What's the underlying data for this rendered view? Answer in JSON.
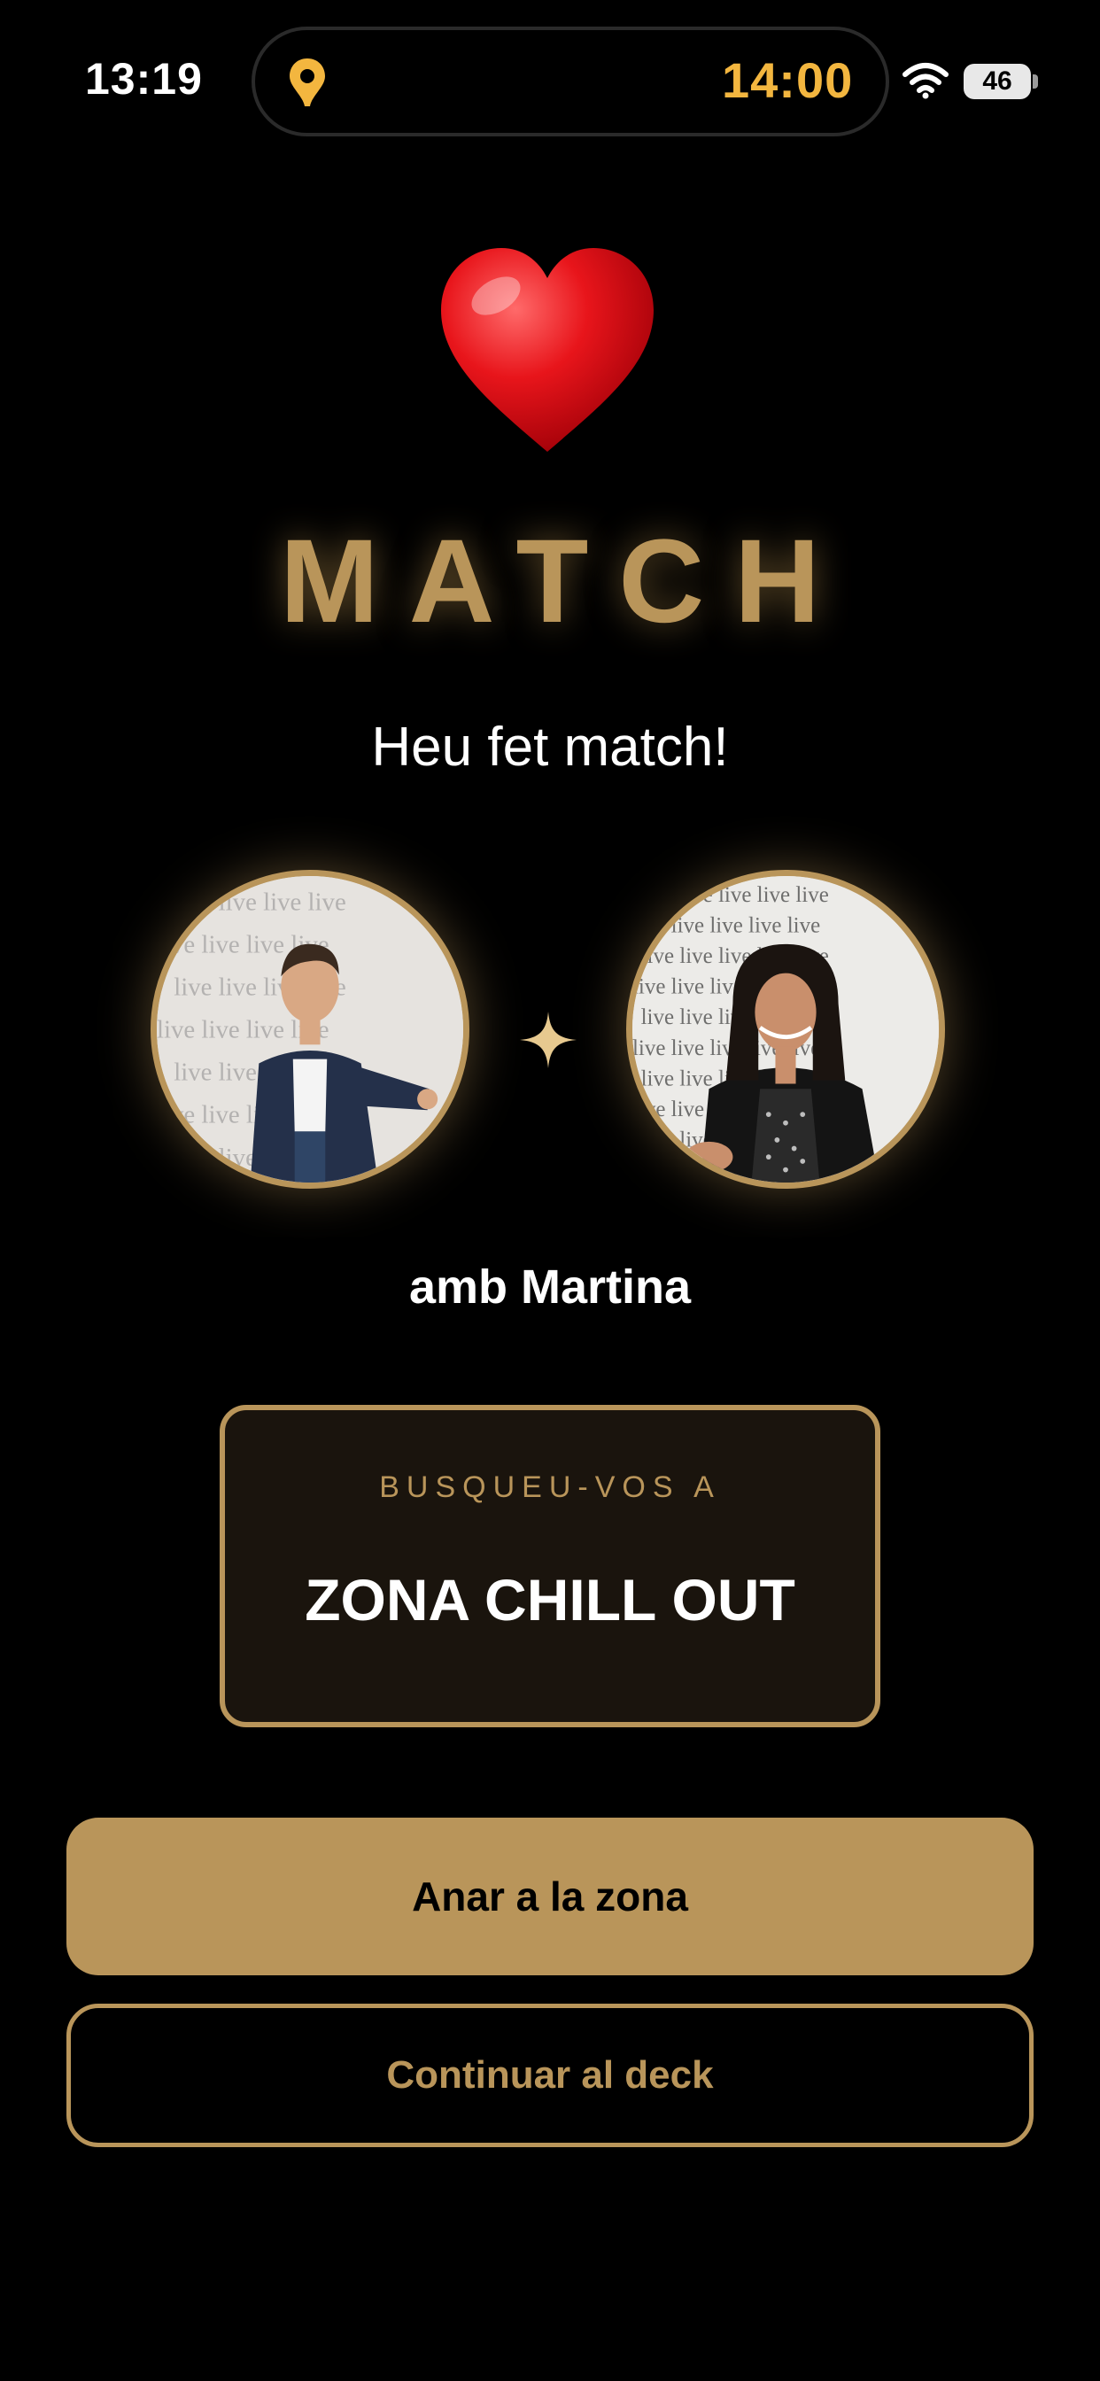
{
  "status_bar": {
    "time": "13:19",
    "island_time": "14:00",
    "battery": "46",
    "icons": [
      "location-pin-icon",
      "wifi-icon",
      "battery-icon"
    ]
  },
  "match": {
    "heart_icon": "heart-icon",
    "title": "MATCH",
    "subtitle": "Heu fet match!",
    "separator_icon": "sparkle-icon",
    "partner_line": "amb Martina"
  },
  "zone_card": {
    "label": "BUSQUEU-VOS A",
    "name": "ZONA CHILL OUT"
  },
  "actions": {
    "primary_label": "Anar a la zona",
    "secondary_label": "Continuar al deck"
  },
  "colors": {
    "accent": "#b9955a",
    "island_time": "#f3b63f",
    "background": "#000000",
    "card_bg": "#1a140d"
  }
}
